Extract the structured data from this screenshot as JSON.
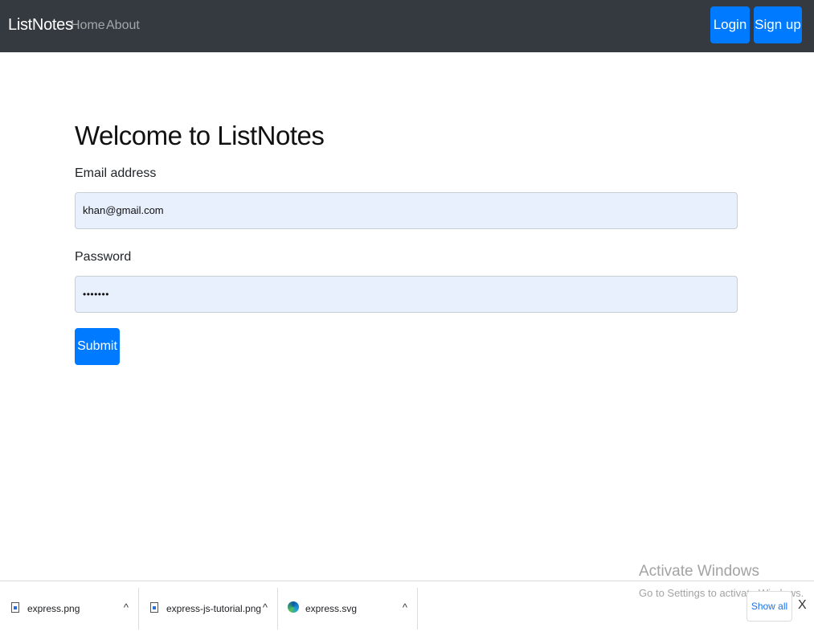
{
  "navbar": {
    "brand": "ListNotes",
    "links": [
      "Home",
      "About"
    ],
    "login_label": "Login",
    "signup_label": "Sign up"
  },
  "form": {
    "title": "Welcome to ListNotes",
    "email_label": "Email address",
    "email_value": "khan@gmail.com",
    "password_label": "Password",
    "password_value": "•••••••",
    "submit_label": "Submit"
  },
  "watermark": {
    "title": "Activate Windows",
    "subtitle": "Go to Settings to activate Windows."
  },
  "downloads": {
    "items": [
      {
        "name": "express.png",
        "icon": "image-file-icon"
      },
      {
        "name": "express-js-tutorial.png",
        "icon": "image-file-icon"
      },
      {
        "name": "express.svg",
        "icon": "edge-browser-icon"
      }
    ],
    "show_all_label": "Show all",
    "close_label": "X"
  },
  "colors": {
    "navbar_bg": "#343a40",
    "primary": "#007bff",
    "autofill_bg": "#e8f0fe"
  }
}
